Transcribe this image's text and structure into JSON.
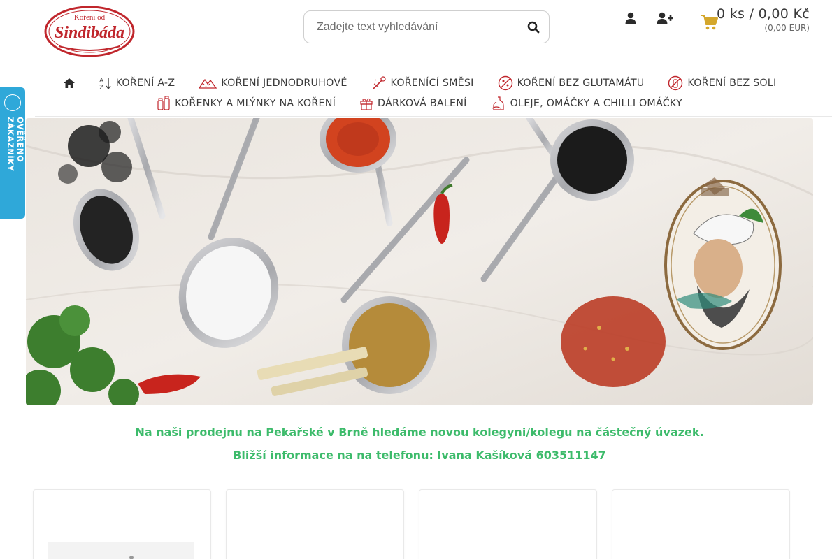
{
  "brand": {
    "logo_text_top": "Koření od",
    "logo_text_main": "Sindibáda",
    "logo_color": "#c0262c"
  },
  "search": {
    "placeholder": "Zadejte text vyhledávání",
    "icon": "search-icon"
  },
  "account": {
    "login_icon": "user-icon",
    "register_icon": "user-plus-icon"
  },
  "cart": {
    "icon": "shopping-cart-icon",
    "summary": "0 ks / 0,00 Kč",
    "eur": "(0,00 EUR)",
    "icon_color": "#d4a72c"
  },
  "nav": {
    "home_icon": "home-icon",
    "row1": [
      {
        "label": "KOŘENÍ A-Z",
        "icon": "sort-az-icon"
      },
      {
        "label": "KOŘENÍ JEDNODRUHOVÉ",
        "icon": "mountain-spice-icon"
      },
      {
        "label": "KOŘENÍCÍ SMĚSI",
        "icon": "spice-mix-icon"
      },
      {
        "label": "KOŘENÍ BEZ GLUTAMÁTU",
        "icon": "no-glutamate-icon"
      },
      {
        "label": "KOŘENÍ BEZ SOLI",
        "icon": "no-salt-icon"
      }
    ],
    "row2": [
      {
        "label": "KOŘENKY A MLÝNKY NA KOŘENÍ",
        "icon": "spice-jar-icon"
      },
      {
        "label": "DÁRKOVÁ BALENÍ",
        "icon": "gift-icon"
      },
      {
        "label": "OLEJE, OMÁČKY A CHILLI OMÁČKY",
        "icon": "oil-bottle-icon"
      }
    ]
  },
  "side_badge": {
    "label": "OVĚŘENO ZÁKAZNÍKY",
    "color": "#2fa8d9"
  },
  "hero": {
    "description_icon": "spices-banner-image"
  },
  "announcement": {
    "line1": "Na naši prodejnu na Pekařské v Brně hledáme novou kolegyni/kolegu na částečný úvazek.",
    "line2": "Bližší informace na na telefonu: Ivana Kašíková 603511147",
    "color": "#3dbb6b"
  },
  "products": [
    {
      "id": 1
    },
    {
      "id": 2
    },
    {
      "id": 3
    },
    {
      "id": 4
    }
  ]
}
